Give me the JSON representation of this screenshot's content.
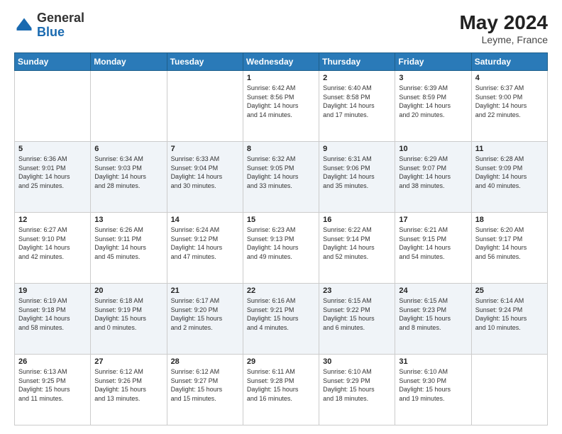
{
  "header": {
    "logo_general": "General",
    "logo_blue": "Blue",
    "month_year": "May 2024",
    "location": "Leyme, France"
  },
  "days_of_week": [
    "Sunday",
    "Monday",
    "Tuesday",
    "Wednesday",
    "Thursday",
    "Friday",
    "Saturday"
  ],
  "weeks": [
    [
      {
        "day": "",
        "info": ""
      },
      {
        "day": "",
        "info": ""
      },
      {
        "day": "",
        "info": ""
      },
      {
        "day": "1",
        "info": "Sunrise: 6:42 AM\nSunset: 8:56 PM\nDaylight: 14 hours\nand 14 minutes."
      },
      {
        "day": "2",
        "info": "Sunrise: 6:40 AM\nSunset: 8:58 PM\nDaylight: 14 hours\nand 17 minutes."
      },
      {
        "day": "3",
        "info": "Sunrise: 6:39 AM\nSunset: 8:59 PM\nDaylight: 14 hours\nand 20 minutes."
      },
      {
        "day": "4",
        "info": "Sunrise: 6:37 AM\nSunset: 9:00 PM\nDaylight: 14 hours\nand 22 minutes."
      }
    ],
    [
      {
        "day": "5",
        "info": "Sunrise: 6:36 AM\nSunset: 9:01 PM\nDaylight: 14 hours\nand 25 minutes."
      },
      {
        "day": "6",
        "info": "Sunrise: 6:34 AM\nSunset: 9:03 PM\nDaylight: 14 hours\nand 28 minutes."
      },
      {
        "day": "7",
        "info": "Sunrise: 6:33 AM\nSunset: 9:04 PM\nDaylight: 14 hours\nand 30 minutes."
      },
      {
        "day": "8",
        "info": "Sunrise: 6:32 AM\nSunset: 9:05 PM\nDaylight: 14 hours\nand 33 minutes."
      },
      {
        "day": "9",
        "info": "Sunrise: 6:31 AM\nSunset: 9:06 PM\nDaylight: 14 hours\nand 35 minutes."
      },
      {
        "day": "10",
        "info": "Sunrise: 6:29 AM\nSunset: 9:07 PM\nDaylight: 14 hours\nand 38 minutes."
      },
      {
        "day": "11",
        "info": "Sunrise: 6:28 AM\nSunset: 9:09 PM\nDaylight: 14 hours\nand 40 minutes."
      }
    ],
    [
      {
        "day": "12",
        "info": "Sunrise: 6:27 AM\nSunset: 9:10 PM\nDaylight: 14 hours\nand 42 minutes."
      },
      {
        "day": "13",
        "info": "Sunrise: 6:26 AM\nSunset: 9:11 PM\nDaylight: 14 hours\nand 45 minutes."
      },
      {
        "day": "14",
        "info": "Sunrise: 6:24 AM\nSunset: 9:12 PM\nDaylight: 14 hours\nand 47 minutes."
      },
      {
        "day": "15",
        "info": "Sunrise: 6:23 AM\nSunset: 9:13 PM\nDaylight: 14 hours\nand 49 minutes."
      },
      {
        "day": "16",
        "info": "Sunrise: 6:22 AM\nSunset: 9:14 PM\nDaylight: 14 hours\nand 52 minutes."
      },
      {
        "day": "17",
        "info": "Sunrise: 6:21 AM\nSunset: 9:15 PM\nDaylight: 14 hours\nand 54 minutes."
      },
      {
        "day": "18",
        "info": "Sunrise: 6:20 AM\nSunset: 9:17 PM\nDaylight: 14 hours\nand 56 minutes."
      }
    ],
    [
      {
        "day": "19",
        "info": "Sunrise: 6:19 AM\nSunset: 9:18 PM\nDaylight: 14 hours\nand 58 minutes."
      },
      {
        "day": "20",
        "info": "Sunrise: 6:18 AM\nSunset: 9:19 PM\nDaylight: 15 hours\nand 0 minutes."
      },
      {
        "day": "21",
        "info": "Sunrise: 6:17 AM\nSunset: 9:20 PM\nDaylight: 15 hours\nand 2 minutes."
      },
      {
        "day": "22",
        "info": "Sunrise: 6:16 AM\nSunset: 9:21 PM\nDaylight: 15 hours\nand 4 minutes."
      },
      {
        "day": "23",
        "info": "Sunrise: 6:15 AM\nSunset: 9:22 PM\nDaylight: 15 hours\nand 6 minutes."
      },
      {
        "day": "24",
        "info": "Sunrise: 6:15 AM\nSunset: 9:23 PM\nDaylight: 15 hours\nand 8 minutes."
      },
      {
        "day": "25",
        "info": "Sunrise: 6:14 AM\nSunset: 9:24 PM\nDaylight: 15 hours\nand 10 minutes."
      }
    ],
    [
      {
        "day": "26",
        "info": "Sunrise: 6:13 AM\nSunset: 9:25 PM\nDaylight: 15 hours\nand 11 minutes."
      },
      {
        "day": "27",
        "info": "Sunrise: 6:12 AM\nSunset: 9:26 PM\nDaylight: 15 hours\nand 13 minutes."
      },
      {
        "day": "28",
        "info": "Sunrise: 6:12 AM\nSunset: 9:27 PM\nDaylight: 15 hours\nand 15 minutes."
      },
      {
        "day": "29",
        "info": "Sunrise: 6:11 AM\nSunset: 9:28 PM\nDaylight: 15 hours\nand 16 minutes."
      },
      {
        "day": "30",
        "info": "Sunrise: 6:10 AM\nSunset: 9:29 PM\nDaylight: 15 hours\nand 18 minutes."
      },
      {
        "day": "31",
        "info": "Sunrise: 6:10 AM\nSunset: 9:30 PM\nDaylight: 15 hours\nand 19 minutes."
      },
      {
        "day": "",
        "info": ""
      }
    ]
  ]
}
